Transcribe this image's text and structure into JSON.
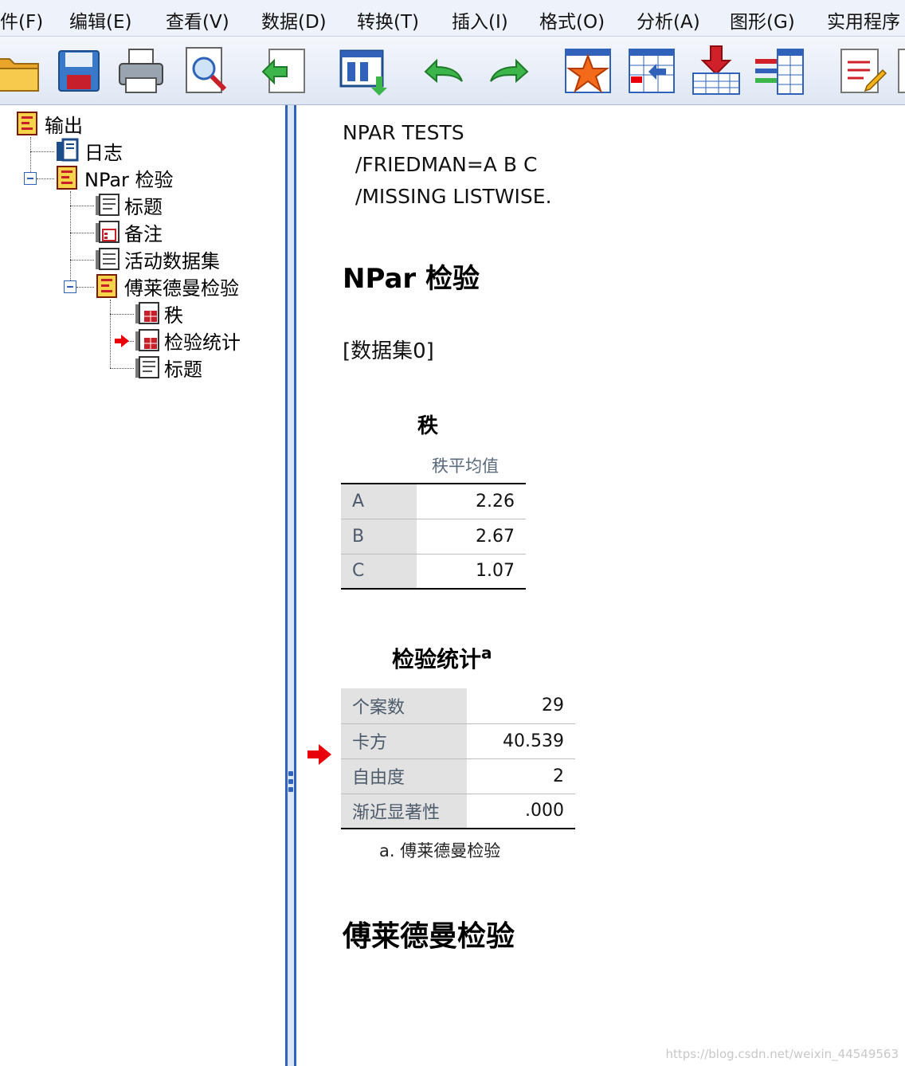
{
  "menu": [
    "件(F)",
    "编辑(E)",
    "查看(V)",
    "数据(D)",
    "转换(T)",
    "插入(I)",
    "格式(O)",
    "分析(A)",
    "图形(G)",
    "实用程序"
  ],
  "toolbar": [
    {
      "icon": "open-folder-icon"
    },
    {
      "icon": "save-icon"
    },
    {
      "icon": "print-icon"
    },
    {
      "icon": "print-preview-icon"
    },
    {
      "icon": "export-icon"
    },
    {
      "icon": "recall-dialog-icon"
    },
    {
      "icon": "undo-icon"
    },
    {
      "icon": "redo-icon"
    },
    {
      "icon": "designate-window-icon"
    },
    {
      "icon": "goto-data-icon"
    },
    {
      "icon": "insert-variable-icon"
    },
    {
      "icon": "variables-icon"
    },
    {
      "icon": "notes-icon"
    }
  ],
  "tree": {
    "root": "输出",
    "log": "日志",
    "npar": "NPar 检验",
    "npar_title": "标题",
    "notes": "备注",
    "active_dataset": "活动数据集",
    "friedman": "傅莱德曼检验",
    "ranks": "秩",
    "test_stats": "检验统计",
    "friedman_title": "标题"
  },
  "content": {
    "syntax": [
      "NPAR TESTS",
      "  /FRIEDMAN=A B C",
      "  /MISSING LISTWISE."
    ],
    "heading": "NPar 检验",
    "dataset": "[数据集0]",
    "ranks_table": {
      "title": "秩",
      "column": "秩平均值",
      "rows": [
        {
          "label": "A",
          "value": "2.26"
        },
        {
          "label": "B",
          "value": "2.67"
        },
        {
          "label": "C",
          "value": "1.07"
        }
      ]
    },
    "stats_table": {
      "title": "检验统计",
      "superscript": "a",
      "rows": [
        {
          "label": "个案数",
          "value": "29"
        },
        {
          "label": "卡方",
          "value": "40.539"
        },
        {
          "label": "自由度",
          "value": "2"
        },
        {
          "label": "渐近显著性",
          "value": ".000"
        }
      ],
      "footnote": "a. 傅莱德曼检验"
    },
    "friedman_heading": "傅莱德曼检验"
  },
  "watermark": "https://blog.csdn.net/weixin_44549563",
  "colors": {
    "accent": "#2f62b8",
    "selection_arrow": "#e8000a"
  }
}
